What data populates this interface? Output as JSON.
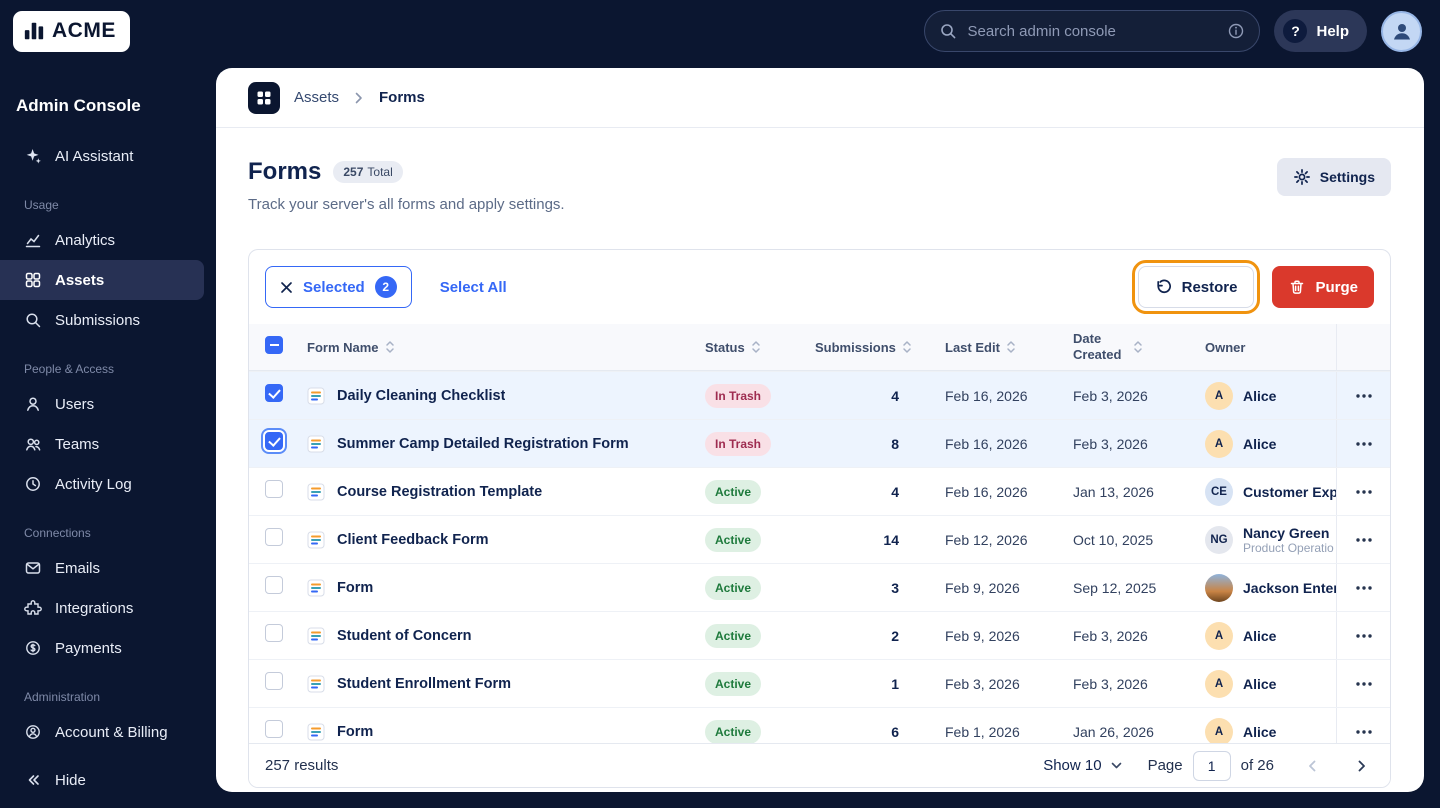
{
  "topbar": {
    "logo": "ACME",
    "search": {
      "placeholder": "Search admin console"
    },
    "help_label": "Help"
  },
  "sidebar": {
    "title": "Admin Console",
    "ai_assistant": "AI Assistant",
    "sections": [
      {
        "label": "Usage",
        "items": [
          {
            "label": "Analytics"
          },
          {
            "label": "Assets"
          },
          {
            "label": "Submissions"
          }
        ]
      },
      {
        "label": "People & Access",
        "items": [
          {
            "label": "Users"
          },
          {
            "label": "Teams"
          },
          {
            "label": "Activity Log"
          }
        ]
      },
      {
        "label": "Connections",
        "items": [
          {
            "label": "Emails"
          },
          {
            "label": "Integrations"
          },
          {
            "label": "Payments"
          }
        ]
      },
      {
        "label": "Administration",
        "items": [
          {
            "label": "Account & Billing"
          }
        ]
      }
    ],
    "hide_label": "Hide"
  },
  "breadcrumb": {
    "parent": "Assets",
    "current": "Forms"
  },
  "page": {
    "title": "Forms",
    "total_count": "257",
    "total_suffix": "Total",
    "subtitle": "Track your server's all forms and apply settings.",
    "settings_label": "Settings"
  },
  "toolbar": {
    "selected_label": "Selected",
    "selected_count": "2",
    "select_all_label": "Select All",
    "restore_label": "Restore",
    "purge_label": "Purge"
  },
  "table": {
    "headers": {
      "form_name": "Form Name",
      "status": "Status",
      "submissions": "Submissions",
      "last_edit": "Last Edit",
      "date_created": "Date Created",
      "owner": "Owner"
    },
    "rows": [
      {
        "name": "Daily Cleaning Checklist",
        "status": "In Trash",
        "submissions": "4",
        "last_edit": "Feb 16, 2026",
        "date_created": "Feb 3, 2026",
        "owner_initials": "A",
        "owner_name": "Alice"
      },
      {
        "name": "Summer Camp Detailed Registration Form",
        "status": "In Trash",
        "submissions": "8",
        "last_edit": "Feb 16, 2026",
        "date_created": "Feb 3, 2026",
        "owner_initials": "A",
        "owner_name": "Alice"
      },
      {
        "name": "Course Registration Template",
        "status": "Active",
        "submissions": "4",
        "last_edit": "Feb 16, 2026",
        "date_created": "Jan 13, 2026",
        "owner_initials": "CE",
        "owner_name": "Customer Exp"
      },
      {
        "name": "Client Feedback Form",
        "status": "Active",
        "submissions": "14",
        "last_edit": "Feb 12, 2026",
        "date_created": "Oct 10, 2025",
        "owner_initials": "NG",
        "owner_name": "Nancy Green",
        "owner_sub": "Product Operatio"
      },
      {
        "name": "Form",
        "status": "Active",
        "submissions": "3",
        "last_edit": "Feb 9, 2026",
        "date_created": "Sep 12, 2025",
        "owner_name": "Jackson Enter"
      },
      {
        "name": "Student of Concern",
        "status": "Active",
        "submissions": "2",
        "last_edit": "Feb 9, 2026",
        "date_created": "Feb 3, 2026",
        "owner_initials": "A",
        "owner_name": "Alice"
      },
      {
        "name": "Student Enrollment Form",
        "status": "Active",
        "submissions": "1",
        "last_edit": "Feb 3, 2026",
        "date_created": "Feb 3, 2026",
        "owner_initials": "A",
        "owner_name": "Alice"
      },
      {
        "name": "Form",
        "status": "Active",
        "submissions": "6",
        "last_edit": "Feb 1, 2026",
        "date_created": "Jan 26, 2026",
        "owner_initials": "A",
        "owner_name": "Alice"
      }
    ]
  },
  "footer": {
    "results": "257 results",
    "show_label": "Show 10",
    "page_label": "Page",
    "page_value": "1",
    "of_label": "of 26"
  },
  "colors": {
    "accent_blue": "#3568f6",
    "navy": "#0b1630",
    "highlight_orange": "#f0930f",
    "danger_red": "#da392c",
    "status_active_bg": "#def0e3",
    "status_active_text": "#1e7a3c",
    "status_trash_bg": "#f9e0e6",
    "status_trash_text": "#9e2c50"
  },
  "icons": {
    "topbar": [
      "acme-logo-icon",
      "search-icon",
      "info-icon",
      "help-icon",
      "user-avatar-icon"
    ],
    "sidebar": [
      "sparkle-icon",
      "analytics-icon",
      "assets-icon",
      "submissions-icon",
      "users-icon",
      "teams-icon",
      "activity-log-icon",
      "emails-icon",
      "integrations-icon",
      "payments-icon",
      "account-billing-icon",
      "hide-icon"
    ],
    "content": [
      "grid-icon",
      "chevron-right-icon",
      "gear-icon",
      "close-icon",
      "restore-icon",
      "trash-icon",
      "sort-icon",
      "form-icon",
      "ellipsis-icon",
      "chevron-down-icon",
      "chevron-left-icon",
      "checkbox"
    ]
  }
}
